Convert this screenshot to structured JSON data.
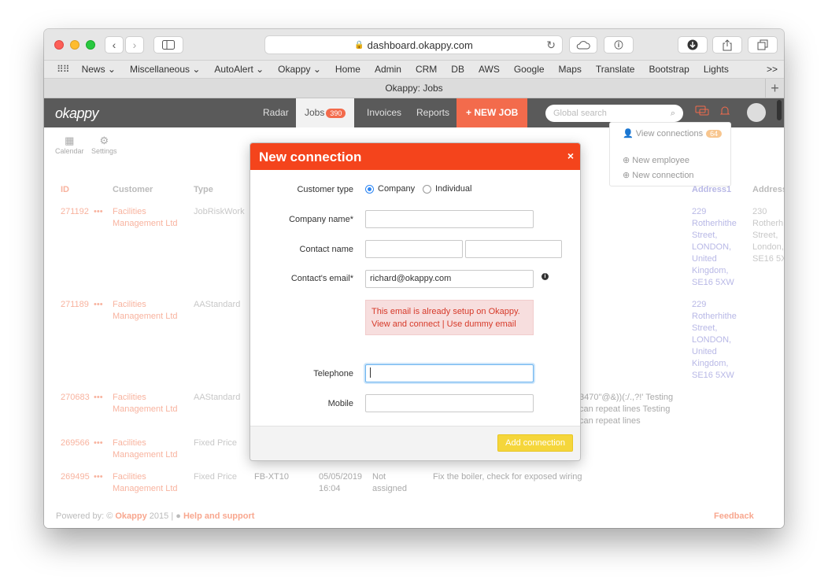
{
  "browser": {
    "url": "dashboard.okappy.com",
    "tab_title": "Okappy: Jobs",
    "bookmarks": [
      "News ⌄",
      "Miscellaneous ⌄",
      "AutoAlert ⌄",
      "Okappy ⌄",
      "Home",
      "Admin",
      "CRM",
      "DB",
      "AWS",
      "Google",
      "Maps",
      "Translate",
      "Bootstrap",
      "Lights"
    ],
    "more": ">>"
  },
  "app": {
    "logo": "okappy",
    "nav": {
      "radar": "Radar",
      "jobs": "Jobs",
      "jobs_count": "390",
      "invoices": "Invoices",
      "reports": "Reports",
      "new_job": "+ NEW JOB"
    },
    "search_placeholder": "Global search",
    "menu": {
      "view_connections": "View connections",
      "connections_count": "64",
      "new_employee": "New employee",
      "new_connection": "New connection"
    },
    "subtools": {
      "calendar": "Calendar",
      "settings": "Settings"
    },
    "table": {
      "headers": [
        "ID",
        "Customer",
        "Type",
        "Address1",
        "Address"
      ],
      "rows": [
        {
          "id": "271192",
          "dots": "•••",
          "customer": "Facilities\nManagement Ltd",
          "type": "JobRiskWork",
          "address1": "229\nRotherhithe\nStreet,\nLONDON,\nUnited\nKingdom,\nSE16 5XW",
          "address2": "230\nRotherh\nStreet,\nLondon,\nSE16 5X"
        },
        {
          "id": "271189",
          "dots": "•••",
          "customer": "Facilities\nManagement Ltd",
          "type": "AAStandard",
          "address1": "229\nRotherhithe\nStreet,\nLONDON,\nUnited\nKingdom,\nSE16 5XW",
          "address2": ""
        },
        {
          "id": "270683",
          "dots": "•••",
          "customer": "Facilities\nManagement Ltd",
          "type": "AAStandard",
          "desc": "3470\"@&))(:/.,?!' Testing\ncan repeat lines Testing\ncan repeat lines"
        },
        {
          "id": "269566",
          "dots": "•••",
          "customer": "Facilities\nManagement Ltd",
          "type": "Fixed Price"
        },
        {
          "id": "269495",
          "dots": "•••",
          "customer": "Facilities\nManagement Ltd",
          "type": "Fixed Price",
          "ref": "FB-XT10",
          "date": "05/05/2019\n16:04",
          "status": "Not\nassigned",
          "desc": "Fix the boiler, check for exposed wiring"
        }
      ]
    },
    "footer": {
      "powered": "Powered by: ©",
      "brand": "Okappy",
      "year": "2015 |",
      "help": "Help and support",
      "feedback": "Feedback"
    }
  },
  "modal": {
    "title": "New connection",
    "close": "×",
    "customer_type_label": "Customer type",
    "option_company": "Company",
    "option_individual": "Individual",
    "company_name_label": "Company name*",
    "company_name_value": "",
    "contact_name_label": "Contact name",
    "contact_first_value": "",
    "contact_last_value": "",
    "email_label": "Contact's email*",
    "email_value": "richard@okappy.com",
    "info_icon": "i",
    "alert_line1": "This email is already setup on Okappy.",
    "alert_view": "View and connect",
    "alert_sep": " | ",
    "alert_dummy": "Use dummy email",
    "telephone_label": "Telephone",
    "telephone_value": "",
    "mobile_label": "Mobile",
    "mobile_value": "",
    "add_button": "Add connection"
  }
}
